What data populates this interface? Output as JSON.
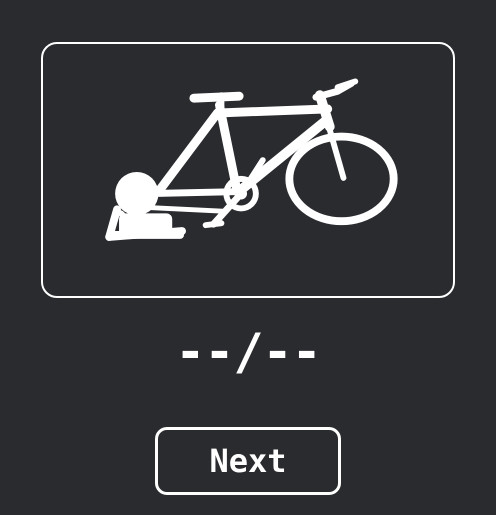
{
  "workout": {
    "image_icon": "stationary-bike-trainer-icon",
    "counter_text": "--/--"
  },
  "controls": {
    "next_label": "Next"
  },
  "colors": {
    "background": "#2a2b2f",
    "foreground": "#ffffff"
  }
}
